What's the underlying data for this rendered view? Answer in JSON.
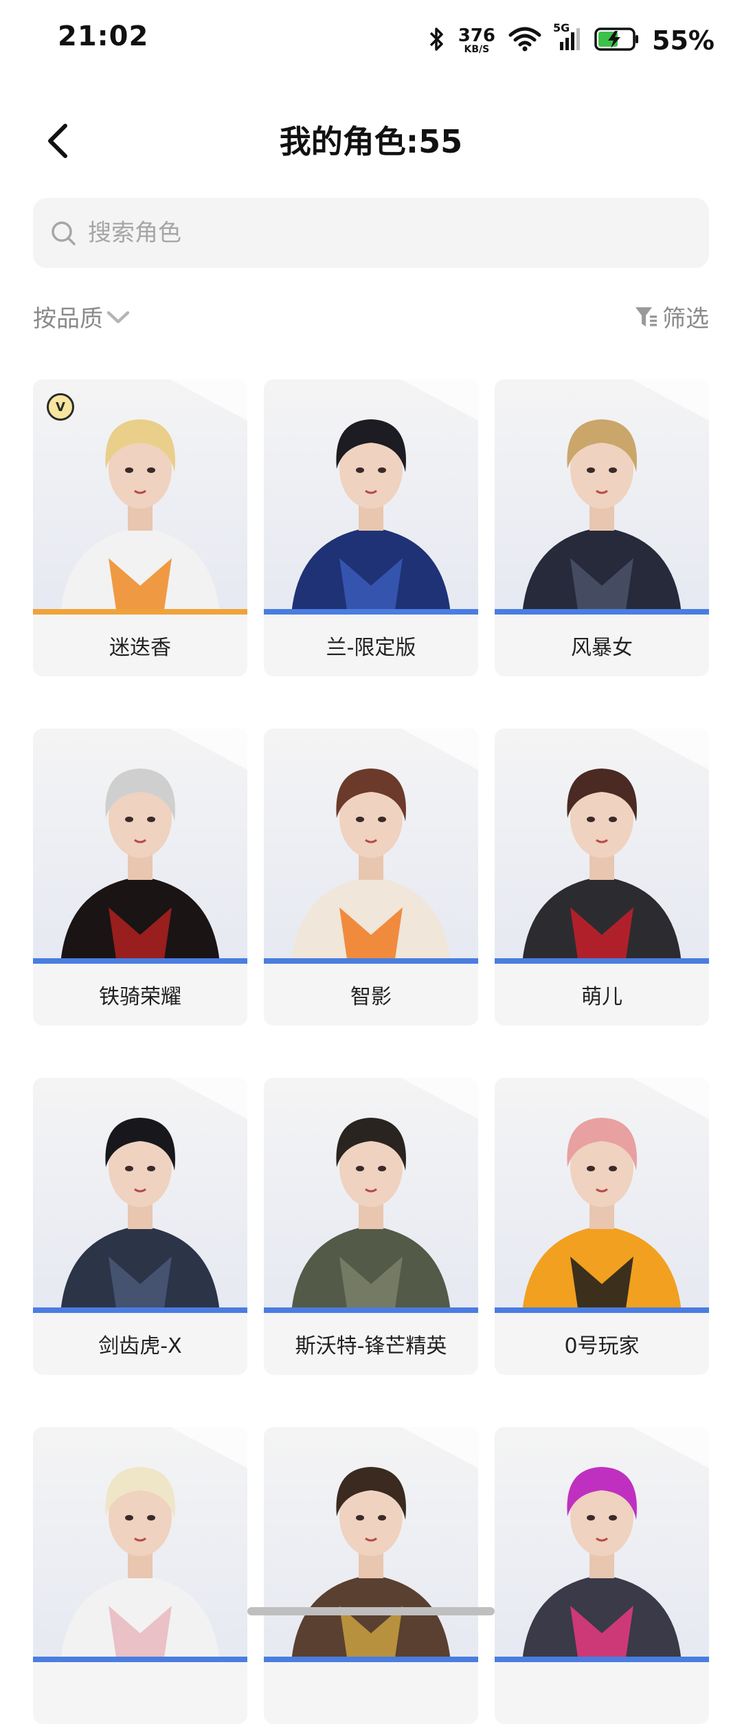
{
  "status": {
    "time": "21:02",
    "net_speed_value": "376",
    "net_speed_unit": "KB/S",
    "signal_type": "5G",
    "battery_pct": "55%",
    "icons": [
      "bluetooth-icon",
      "wifi-icon",
      "cellular-signal-icon",
      "battery-charging-icon"
    ]
  },
  "header": {
    "title": "我的角色:55",
    "back_icon": "chevron-left-icon"
  },
  "search": {
    "placeholder": "搜索角色",
    "icon": "search-icon"
  },
  "sort": {
    "label": "按品质",
    "icon": "chevron-down-icon"
  },
  "filter": {
    "label": "筛选",
    "icon": "filter-icon"
  },
  "characters": [
    {
      "name": "迷迭香",
      "badge": "V",
      "quality_color": "#f0a23a",
      "hair": "#e9cf8a",
      "outfit": "#f2f2f2",
      "accent": "#f08a24"
    },
    {
      "name": "兰-限定版",
      "quality_color": "#4a7de0",
      "hair": "#1c1c22",
      "outfit": "#1f3276",
      "accent": "#3a5bb8"
    },
    {
      "name": "风暴女",
      "quality_color": "#4a7de0",
      "hair": "#caa66a",
      "outfit": "#262a3a",
      "accent": "#4b5268"
    },
    {
      "name": "铁骑荣耀",
      "quality_color": "#4a7de0",
      "hair": "#cfcfcf",
      "outfit": "#1a1414",
      "accent": "#b02020"
    },
    {
      "name": "智影",
      "quality_color": "#4a7de0",
      "hair": "#6b3a2a",
      "outfit": "#f0e6da",
      "accent": "#f07a22"
    },
    {
      "name": "萌儿",
      "quality_color": "#4a7de0",
      "hair": "#4a2a22",
      "outfit": "#2c2c30",
      "accent": "#c81e2a"
    },
    {
      "name": "剑齿虎-X",
      "quality_color": "#4a7de0",
      "hair": "#18181c",
      "outfit": "#2c3448",
      "accent": "#4a5878"
    },
    {
      "name": "斯沃特-锋芒精英",
      "quality_color": "#4a7de0",
      "hair": "#2a2420",
      "outfit": "#545a48",
      "accent": "#7a8068"
    },
    {
      "name": "0号玩家",
      "quality_color": "#4a7de0",
      "hair": "#e8a0a0",
      "outfit": "#f2a020",
      "accent": "#1c1c1c"
    },
    {
      "name": "",
      "quality_color": "#4a7de0",
      "hair": "#efe6c8",
      "outfit": "#f2f2f2",
      "accent": "#e8b8c0"
    },
    {
      "name": "",
      "quality_color": "#4a7de0",
      "hair": "#3a2a20",
      "outfit": "#5a4030",
      "accent": "#c8a040"
    },
    {
      "name": "",
      "quality_color": "#4a7de0",
      "hair": "#c030c0",
      "outfit": "#3a3a48",
      "accent": "#e83a80"
    }
  ]
}
